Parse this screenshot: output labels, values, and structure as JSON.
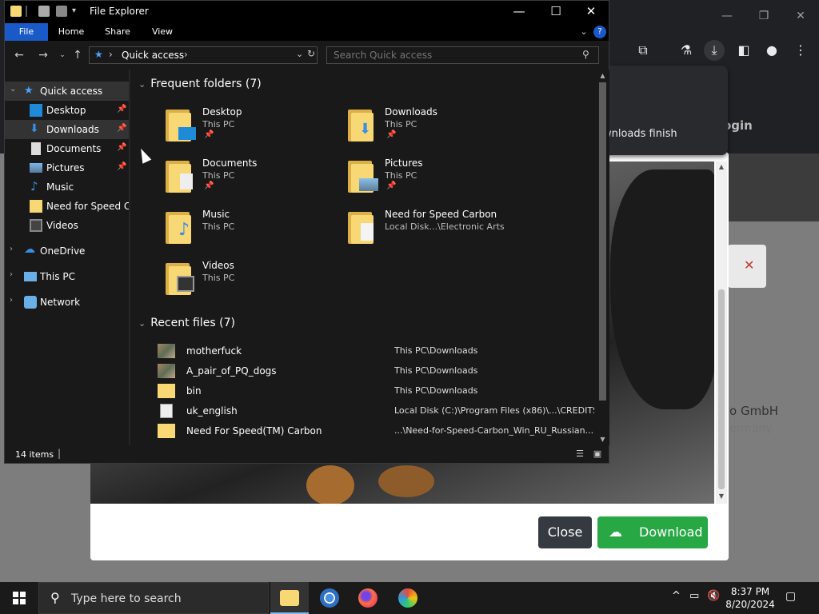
{
  "browser": {
    "downloads_popup_text": "wnloads finish",
    "login_text": "ogin",
    "modal": {
      "close_label": "Close",
      "download_label": "Download"
    },
    "company_text": "o GmbH",
    "country_text": "ermany"
  },
  "explorer": {
    "title": "File Explorer",
    "ribbon_tabs": [
      "File",
      "Home",
      "Share",
      "View"
    ],
    "address": {
      "location": "Quick access"
    },
    "search": {
      "placeholder": "Search Quick access"
    },
    "nav": {
      "quick_access": "Quick access",
      "items": [
        {
          "label": "Desktop",
          "pinned": true
        },
        {
          "label": "Downloads",
          "pinned": true
        },
        {
          "label": "Documents",
          "pinned": true
        },
        {
          "label": "Pictures",
          "pinned": true
        },
        {
          "label": "Music"
        },
        {
          "label": "Need for Speed Car"
        },
        {
          "label": "Videos"
        }
      ],
      "onedrive": "OneDrive",
      "this_pc": "This PC",
      "network": "Network"
    },
    "frequent": {
      "header": "Frequent folders (7)",
      "folders": [
        {
          "name": "Desktop",
          "location": "This PC"
        },
        {
          "name": "Downloads",
          "location": "This PC"
        },
        {
          "name": "Documents",
          "location": "This PC"
        },
        {
          "name": "Pictures",
          "location": "This PC"
        },
        {
          "name": "Music",
          "location": "This PC"
        },
        {
          "name": "Need for Speed Carbon",
          "location": "Local Disk...\\Electronic Arts"
        },
        {
          "name": "Videos",
          "location": "This PC"
        }
      ]
    },
    "recent": {
      "header": "Recent files (7)",
      "files": [
        {
          "name": "motherfuck",
          "location": "This PC\\Downloads"
        },
        {
          "name": "A_pair_of_PQ_dogs",
          "location": "This PC\\Downloads"
        },
        {
          "name": "bin",
          "location": "This PC\\Downloads"
        },
        {
          "name": "uk_english",
          "location": "Local Disk (C:)\\Program Files (x86)\\...\\CREDITS"
        },
        {
          "name": "Need For Speed(TM) Carbon",
          "location": "...\\Need-for-Speed-Carbon_Win_RU_Russian..."
        }
      ]
    },
    "status": {
      "count": "14 items"
    }
  },
  "taskbar": {
    "search_placeholder": "Type here to search",
    "time": "8:37 PM",
    "date": "8/20/2024"
  }
}
